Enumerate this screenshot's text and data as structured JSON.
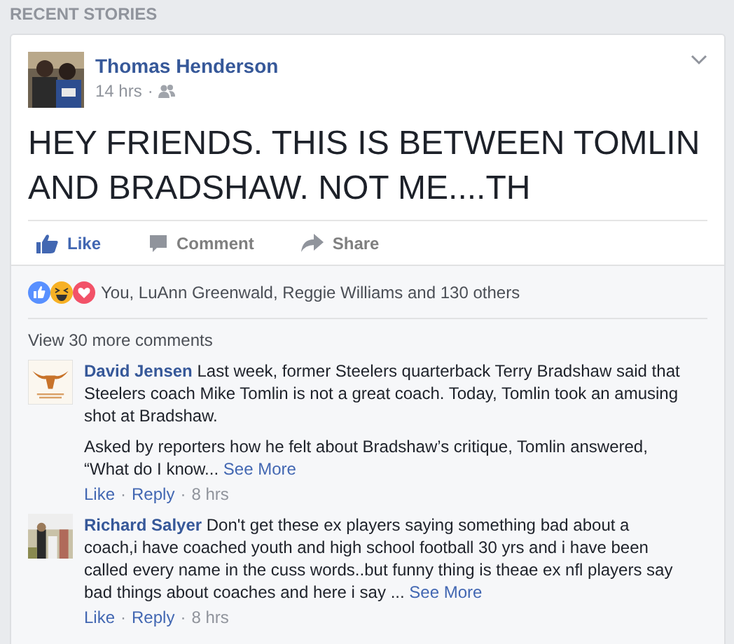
{
  "section_title": "RECENT STORIES",
  "post": {
    "author": "Thomas Henderson",
    "time": "14 hrs",
    "separator": "·",
    "text": "HEY FRIENDS. THIS IS BETWEEN TOMLIN AND BRADSHAW. NOT ME....TH",
    "actions": [
      {
        "label": "Like",
        "kind": "like",
        "selected": true
      },
      {
        "label": "Comment",
        "kind": "comment",
        "selected": false
      },
      {
        "label": "Share",
        "kind": "share",
        "selected": false
      }
    ],
    "reactions": {
      "icons": [
        {
          "kind": "like"
        },
        {
          "kind": "haha"
        },
        {
          "kind": "love"
        }
      ],
      "summary": "You, LuAnn Greenwald, Reggie Williams and 130 others"
    },
    "view_more": "View 30 more comments",
    "comments": [
      {
        "author": "David Jensen",
        "paragraphs": [
          "Last week, former Steelers quarterback Terry Bradshaw said that Steelers coach Mike Tomlin is not a great coach. Today, Tomlin took an amusing shot at Bradshaw.",
          "Asked by reporters how he felt about Bradshaw’s critique, Tomlin answered, “What do I know..."
        ],
        "see_more": "See More",
        "like": "Like",
        "reply": "Reply",
        "time": "8 hrs"
      },
      {
        "author": "Richard Salyer",
        "paragraphs": [
          "Don't get these ex players saying something bad about a coach,i have coached youth and high school football 30 yrs and i have been called every name in the cuss words..but funny thing is theae ex nfl players say bad things about coaches and here i say ..."
        ],
        "see_more": "See More",
        "like": "Like",
        "reply": "Reply",
        "time": "8 hrs"
      }
    ]
  }
}
